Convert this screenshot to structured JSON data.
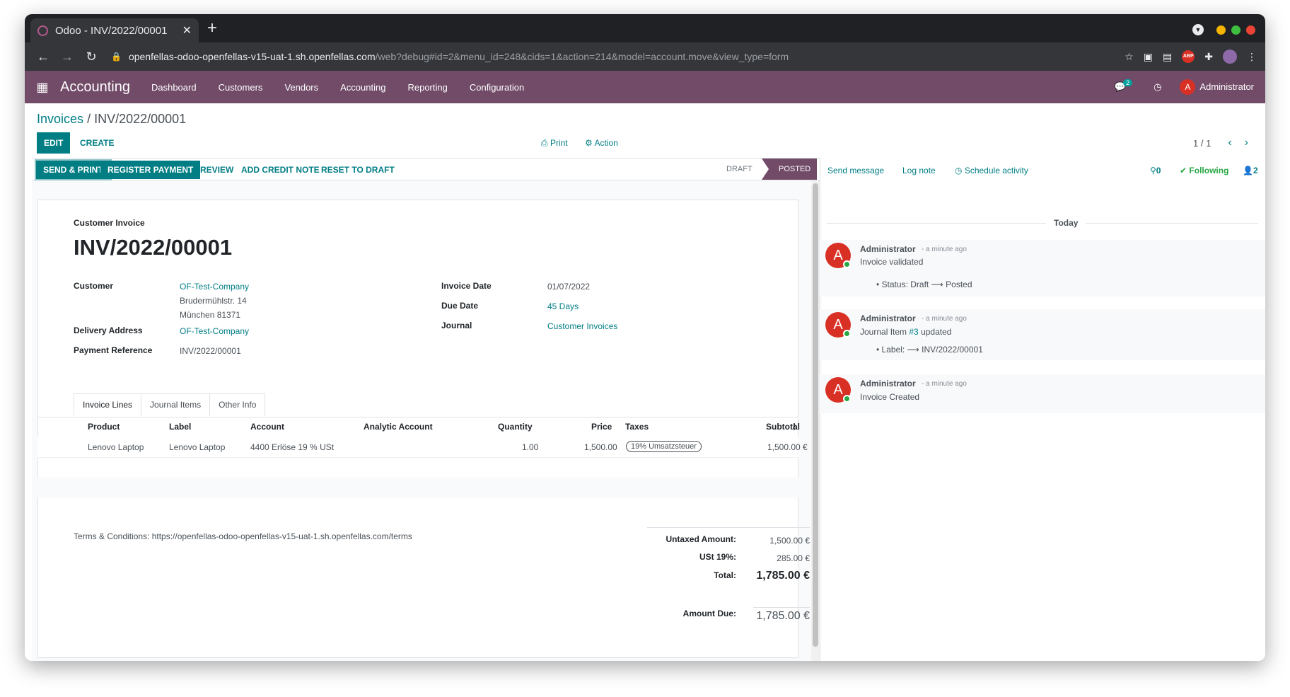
{
  "browser": {
    "tab_title": "Odoo - INV/2022/00001",
    "url_host": "openfellas-odoo-openfellas-v15-uat-1.sh.openfellas.com",
    "url_path": "/web?debug#id=2&menu_id=248&cids=1&action=214&model=account.move&view_type=form"
  },
  "navbar": {
    "app": "Accounting",
    "menu": [
      "Dashboard",
      "Customers",
      "Vendors",
      "Accounting",
      "Reporting",
      "Configuration"
    ],
    "messages_count": "2",
    "user": "Administrator",
    "user_initial": "A"
  },
  "control": {
    "breadcrumb_parent": "Invoices",
    "breadcrumb_sep": "/",
    "breadcrumb_current": "INV/2022/00001",
    "edit": "EDIT",
    "create": "CREATE",
    "print": "Print",
    "action": "Action",
    "pager": "1 / 1"
  },
  "status_buttons": {
    "send_print": "SEND & PRINT",
    "register_payment": "REGISTER PAYMENT",
    "preview": "PREVIEW",
    "credit_note": "ADD CREDIT NOTE",
    "reset_draft": "RESET TO DRAFT",
    "stage_draft": "DRAFT",
    "stage_posted": "POSTED"
  },
  "invoice": {
    "type_label": "Customer Invoice",
    "number": "INV/2022/00001",
    "customer_label": "Customer",
    "customer": "OF-Test-Company",
    "address_line1": "Brudermühlstr. 14",
    "address_line2": "München 81371",
    "delivery_label": "Delivery Address",
    "delivery": "OF-Test-Company",
    "payref_label": "Payment Reference",
    "payref": "INV/2022/00001",
    "date_label": "Invoice Date",
    "date": "01/07/2022",
    "due_label": "Due Date",
    "due": "45 Days",
    "journal_label": "Journal",
    "journal": "Customer Invoices"
  },
  "tabs": [
    "Invoice Lines",
    "Journal Items",
    "Other Info"
  ],
  "lines": {
    "headers": {
      "product": "Product",
      "label": "Label",
      "account": "Account",
      "analytic": "Analytic Account",
      "quantity": "Quantity",
      "price": "Price",
      "taxes": "Taxes",
      "subtotal": "Subtotal"
    },
    "rows": [
      {
        "product": "Lenovo Laptop",
        "label": "Lenovo Laptop",
        "account": "4400 Erlöse 19 % USt",
        "analytic": "",
        "quantity": "1.00",
        "price": "1,500.00",
        "taxes": "19% Umsatzsteuer",
        "subtotal": "1,500.00 €"
      }
    ]
  },
  "terms": "Terms & Conditions: https://openfellas-odoo-openfellas-v15-uat-1.sh.openfellas.com/terms",
  "totals": {
    "untaxed_label": "Untaxed Amount:",
    "untaxed": "1,500.00 €",
    "tax_label": "USt 19%:",
    "tax": "285.00 €",
    "total_label": "Total:",
    "total": "1,785.00 €",
    "due_label": "Amount Due:",
    "due": "1,785.00 €"
  },
  "chatter": {
    "send_message": "Send message",
    "log_note": "Log note",
    "schedule": "Schedule activity",
    "attachments": "0",
    "following": "Following",
    "followers": "2",
    "today": "Today",
    "messages": [
      {
        "author": "Administrator",
        "time": "- a minute ago",
        "body": "Invoice validated",
        "detail_prefix": "Status: Draft",
        "detail_suffix": "Posted"
      },
      {
        "author": "Administrator",
        "time": "- a minute ago",
        "body_pre": "Journal Item ",
        "body_link": "#3",
        "body_post": " updated",
        "detail_prefix": "Label:",
        "detail_suffix": "INV/2022/00001"
      },
      {
        "author": "Administrator",
        "time": "- a minute ago",
        "body": "Invoice Created"
      }
    ]
  },
  "colors": {
    "brand": "#714b67",
    "accent": "#017e84",
    "avatar": "#d93025"
  }
}
